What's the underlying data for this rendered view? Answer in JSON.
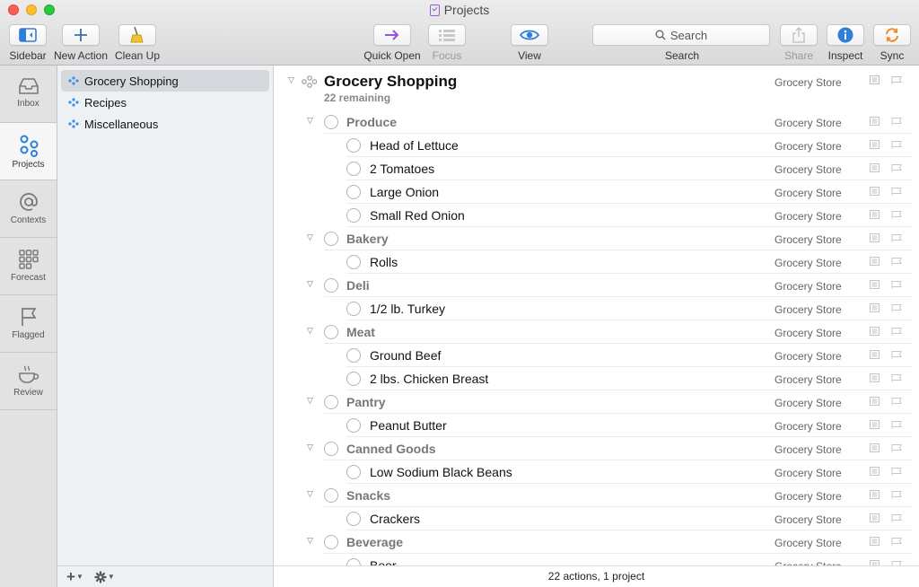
{
  "window": {
    "title": "Projects"
  },
  "toolbar": {
    "sidebar": "Sidebar",
    "new_action": "New Action",
    "clean_up": "Clean Up",
    "quick_open": "Quick Open",
    "focus": "Focus",
    "view": "View",
    "search_placeholder": "Search",
    "search_label": "Search",
    "share": "Share",
    "inspect": "Inspect",
    "sync": "Sync"
  },
  "rail": {
    "items": [
      {
        "label": "Inbox",
        "icon": "inbox-icon"
      },
      {
        "label": "Projects",
        "icon": "projects-icon"
      },
      {
        "label": "Contexts",
        "icon": "at-icon"
      },
      {
        "label": "Forecast",
        "icon": "grid-icon"
      },
      {
        "label": "Flagged",
        "icon": "flag-icon"
      },
      {
        "label": "Review",
        "icon": "coffee-cup-icon"
      }
    ],
    "active": "Projects"
  },
  "sidebar": {
    "projects": [
      {
        "label": "Grocery Shopping",
        "selected": true
      },
      {
        "label": "Recipes",
        "selected": false
      },
      {
        "label": "Miscellaneous",
        "selected": false
      }
    ],
    "bottom": {
      "add": "+",
      "gear": "gear-icon"
    }
  },
  "outline": {
    "project": {
      "title": "Grocery Shopping",
      "remaining": "22 remaining",
      "context": "Grocery Store"
    },
    "rows": [
      {
        "type": "group",
        "title": "Produce",
        "context": "Grocery Store"
      },
      {
        "type": "action",
        "title": "Head of Lettuce",
        "context": "Grocery Store"
      },
      {
        "type": "action",
        "title": "2 Tomatoes",
        "context": "Grocery Store"
      },
      {
        "type": "action",
        "title": "Large Onion",
        "context": "Grocery Store"
      },
      {
        "type": "action",
        "title": "Small Red Onion",
        "context": "Grocery Store"
      },
      {
        "type": "group",
        "title": "Bakery",
        "context": "Grocery Store"
      },
      {
        "type": "action",
        "title": "Rolls",
        "context": "Grocery Store"
      },
      {
        "type": "group",
        "title": "Deli",
        "context": "Grocery Store"
      },
      {
        "type": "action",
        "title": "1/2 lb. Turkey",
        "context": "Grocery Store"
      },
      {
        "type": "group",
        "title": "Meat",
        "context": "Grocery Store"
      },
      {
        "type": "action",
        "title": "Ground Beef",
        "context": "Grocery Store"
      },
      {
        "type": "action",
        "title": "2 lbs. Chicken Breast",
        "context": "Grocery Store"
      },
      {
        "type": "group",
        "title": "Pantry",
        "context": "Grocery Store"
      },
      {
        "type": "action",
        "title": "Peanut Butter",
        "context": "Grocery Store"
      },
      {
        "type": "group",
        "title": "Canned Goods",
        "context": "Grocery Store"
      },
      {
        "type": "action",
        "title": "Low Sodium Black Beans",
        "context": "Grocery Store"
      },
      {
        "type": "group",
        "title": "Snacks",
        "context": "Grocery Store"
      },
      {
        "type": "action",
        "title": "Crackers",
        "context": "Grocery Store"
      },
      {
        "type": "group",
        "title": "Beverage",
        "context": "Grocery Store"
      },
      {
        "type": "action",
        "title": "Beer",
        "context": "Grocery Store"
      }
    ]
  },
  "status": {
    "text": "22 actions, 1 project"
  },
  "colors": {
    "accent_blue": "#2f7fd8",
    "quick_open_purple": "#9a4fe0",
    "sync_orange": "#f08a24"
  }
}
